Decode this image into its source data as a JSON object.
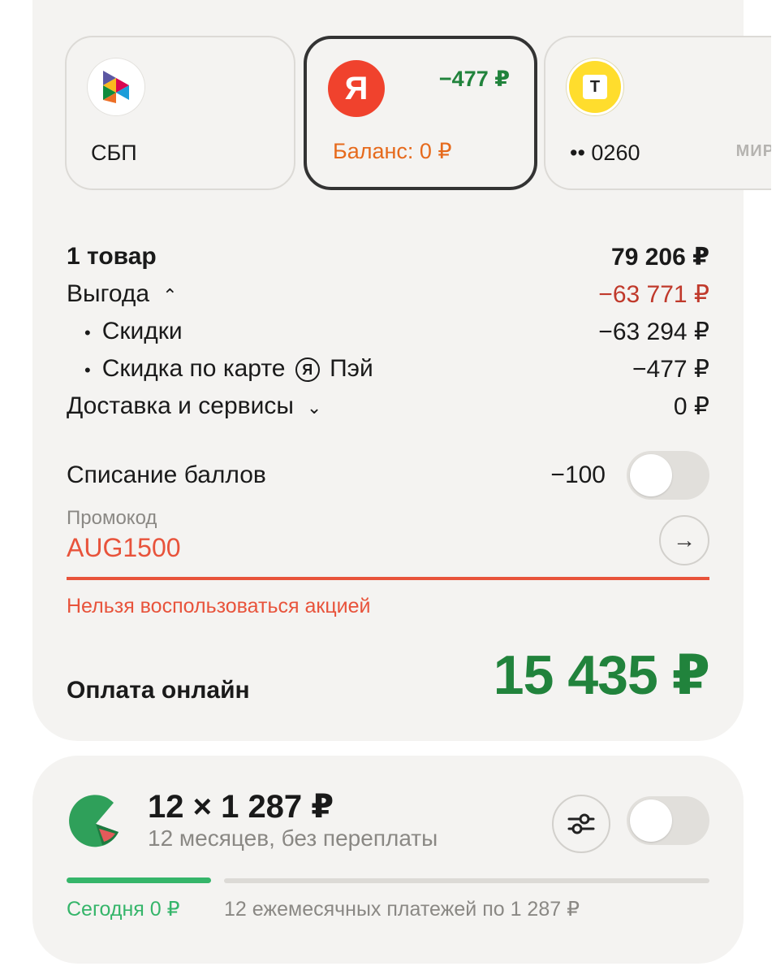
{
  "payment_methods": {
    "sbp": {
      "label": "СБП"
    },
    "yandex": {
      "icon_letter": "Я",
      "discount": "−477 ₽",
      "balance": "Баланс: 0 ₽"
    },
    "tbank": {
      "icon_letter": "Т",
      "card_mask": "•• 0260",
      "network": "МИР"
    }
  },
  "summary": {
    "items_label": "1 товар",
    "items_value": "79 206 ₽",
    "benefit_label": "Выгода",
    "benefit_value": "−63 771 ₽",
    "discounts_label": "Скидки",
    "discounts_value": "−63 294 ₽",
    "card_discount_prefix": "Скидка по карте",
    "card_discount_logo": "Я",
    "card_discount_suffix": "Пэй",
    "card_discount_value": "−477 ₽",
    "delivery_label": "Доставка и сервисы",
    "delivery_value": "0 ₽"
  },
  "points": {
    "label": "Списание баллов",
    "value": "−100",
    "enabled": false
  },
  "promo": {
    "label": "Промокод",
    "value": "AUG1500",
    "error": "Нельзя воспользоваться акцией"
  },
  "payment": {
    "label": "Оплата онлайн",
    "total": "15 435 ₽"
  },
  "split": {
    "amount": "12 × 1 287 ₽",
    "terms": "12 месяцев, без переплаты",
    "enabled": false,
    "today": "Сегодня 0 ₽",
    "monthly": "12 ежемесячных платежей по 1 287 ₽"
  },
  "colors": {
    "accent_green": "#21833c",
    "error_red": "#e8533b",
    "benefit_red": "#c0392b",
    "split_green": "#35b56a",
    "balance_orange": "#e66a1c"
  }
}
